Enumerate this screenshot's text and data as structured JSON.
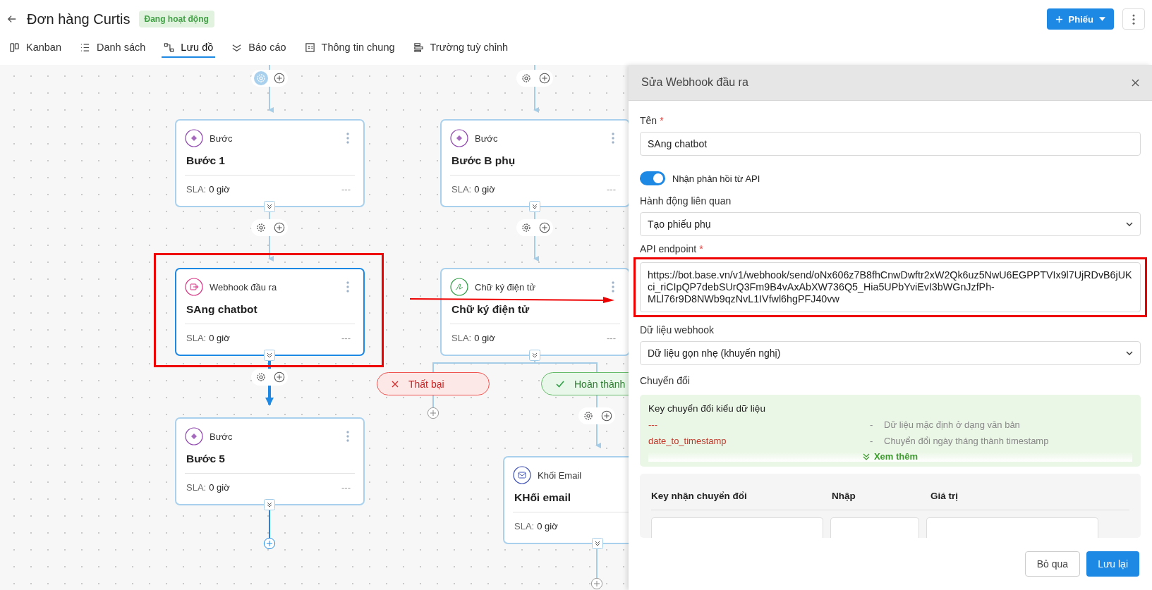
{
  "header": {
    "title": "Đơn hàng Curtis",
    "status": "Đang hoạt động",
    "new_button": "Phiếu"
  },
  "tabs": [
    {
      "label": "Kanban",
      "kind": "kanban",
      "selected": false
    },
    {
      "label": "Danh sách",
      "kind": "list",
      "selected": false
    },
    {
      "label": "Lưu đồ",
      "kind": "flow",
      "selected": true
    },
    {
      "label": "Báo cáo",
      "kind": "report",
      "selected": false
    },
    {
      "label": "Thông tin chung",
      "kind": "info",
      "selected": false
    },
    {
      "label": "Trường tuỳ chỉnh",
      "kind": "fields",
      "selected": false
    }
  ],
  "nodes": [
    {
      "kind": "step",
      "label": "Bước",
      "title": "Bước 1",
      "sla_label": "SLA:",
      "sla_value": "0 giờ",
      "dash": "---",
      "menu": true,
      "selected": false
    },
    {
      "kind": "step",
      "label": "Bước",
      "title": "Bước B phụ",
      "sla_label": "SLA:",
      "sla_value": "0 giờ",
      "dash": "---",
      "menu": true,
      "selected": false
    },
    {
      "kind": "webhook",
      "label": "Webhook đầu ra",
      "title": "SAng chatbot",
      "sla_label": "SLA:",
      "sla_value": "0 giờ",
      "dash": "---",
      "menu": true,
      "selected": true
    },
    {
      "kind": "signature",
      "label": "Chữ ký điện tử",
      "title": "Chữ ký điện tử",
      "sla_label": "SLA:",
      "sla_value": "0 giờ",
      "dash": "---",
      "menu": true,
      "selected": false
    },
    {
      "kind": "step",
      "label": "Bước",
      "title": "Bước 5",
      "sla_label": "SLA:",
      "sla_value": "0 giờ",
      "dash": "---",
      "menu": true,
      "selected": false
    },
    {
      "kind": "email",
      "label": "Khối Email",
      "title": "KHối email",
      "sla_label": "SLA:",
      "sla_value": "0 giờ",
      "selected": false
    }
  ],
  "outcomes": [
    {
      "kind": "fail",
      "label": "Thất bại"
    },
    {
      "kind": "success",
      "label": "Hoàn thành"
    }
  ],
  "panel": {
    "title": "Sửa Webhook đầu ra",
    "name_label": "Tên",
    "name_required": "*",
    "name_value": "SAng chatbot",
    "toggle": {
      "label": "Nhận phản hồi từ API",
      "on": true
    },
    "action_label": "Hành động liên quan",
    "action_value": "Tạo phiếu phụ",
    "endpoint_label": "API endpoint",
    "endpoint_required": "*",
    "endpoint_value": "https://bot.base.vn/v1/webhook/send/oNx606z7B8fhCnwDwftr2xW2Qk6uz5NwU6EGPPTVIx9l7UjRDvB6jUKci_riCIpQP7debSUrQ3Fm9B4vAxAbXW736Q5_Hia5UPbYviEvI3bWGnJzfPh-MLl76r9D8NWb9qzNvL1IVfwl6hgPFJ40vw",
    "data_label": "Dữ liệu webhook",
    "data_value": "Dữ liệu gọn nhẹ (khuyến nghị)",
    "convert_label": "Chuyển đổi",
    "convert_box": {
      "title": "Key chuyển đổi kiểu dữ liệu",
      "rows": [
        {
          "key": "---",
          "separator": "-",
          "description": "Dữ liệu mặc định ở dạng văn bản"
        },
        {
          "key": "date_to_timestamp",
          "separator": "-",
          "description": "Chuyển đổi ngày tháng thành timestamp"
        }
      ],
      "more": "Xem thêm"
    },
    "mapping_columns": [
      "Key nhận chuyển đổi",
      "Nhập",
      "Giá trị"
    ],
    "cancel": "Bỏ qua",
    "save": "Lưu lại"
  }
}
